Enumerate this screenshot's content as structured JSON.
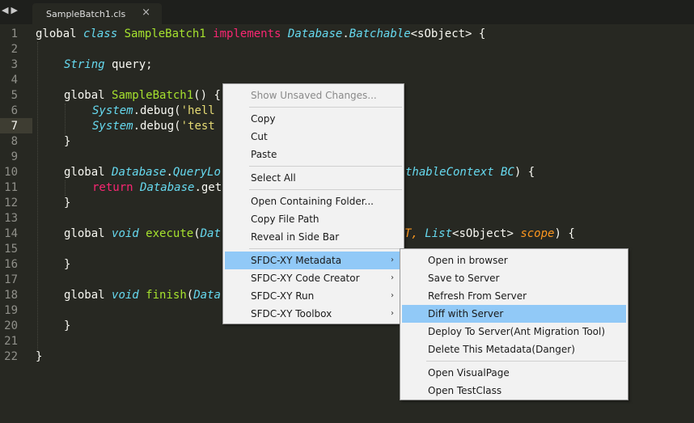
{
  "tabs": [
    {
      "label": "SampleBatch1.cls",
      "close_icon": "×"
    }
  ],
  "nav": {
    "back_icon": "◀",
    "forward_icon": "▶"
  },
  "gutter": {
    "line_numbers": [
      "1",
      "2",
      "3",
      "4",
      "5",
      "6",
      "7",
      "8",
      "9",
      "10",
      "11",
      "12",
      "13",
      "14",
      "15",
      "16",
      "17",
      "18",
      "19",
      "20",
      "21",
      "22"
    ],
    "active_line": "7"
  },
  "code": {
    "l1": {
      "a": "global ",
      "b": "class ",
      "c": "SampleBatch1 ",
      "d": "implements ",
      "e": "Database",
      "f": ".",
      "g": "Batchable",
      "h": "<sObject> {"
    },
    "l3": {
      "a": "String",
      "b": " query;"
    },
    "l5": {
      "a": "global ",
      "b": "SampleBatch1",
      "c": "() {"
    },
    "l6": {
      "a": "System",
      "b": ".debug(",
      "c": "'hell"
    },
    "l7": {
      "a": "System",
      "b": ".debug(",
      "c": "'test"
    },
    "l8": {
      "a": "}"
    },
    "l10": {
      "a": "global ",
      "b": "Database",
      "c": ".",
      "d": "QueryLo",
      "e": "thableContext BC",
      "f": ") {"
    },
    "l11": {
      "a": "return ",
      "b": "Database",
      "c": ".get"
    },
    "l12": {
      "a": "}"
    },
    "l14": {
      "a": "global ",
      "b": "void ",
      "c": "execute",
      "d": "(",
      "e": "Dat",
      "f": "T, ",
      "g": "List",
      "h": "<sObject> ",
      "i": "scope",
      "j": ") {"
    },
    "l16": {
      "a": "}"
    },
    "l18": {
      "a": "global ",
      "b": "void ",
      "c": "finish",
      "d": "(",
      "e": "Data"
    },
    "l20": {
      "a": "}"
    },
    "l22": {
      "a": "}"
    }
  },
  "context_menu": {
    "items": [
      {
        "label": "Show Unsaved Changes...",
        "disabled": true
      },
      {
        "label": "Copy"
      },
      {
        "label": "Cut"
      },
      {
        "label": "Paste"
      },
      {
        "label": "Select All"
      },
      {
        "label": "Open Containing Folder..."
      },
      {
        "label": "Copy File Path"
      },
      {
        "label": "Reveal in Side Bar"
      },
      {
        "label": "SFDC-XY Metadata",
        "submenu": true
      },
      {
        "label": "SFDC-XY Code Creator",
        "submenu": true
      },
      {
        "label": "SFDC-XY Run",
        "submenu": true
      },
      {
        "label": "SFDC-XY Toolbox",
        "submenu": true
      }
    ],
    "submenu_arrow": "›"
  },
  "submenu": {
    "items": [
      {
        "label": "Open in browser"
      },
      {
        "label": "Save to Server"
      },
      {
        "label": "Refresh From Server"
      },
      {
        "label": "Diff with Server"
      },
      {
        "label": "Deploy To Server(Ant Migration Tool)"
      },
      {
        "label": "Delete This Metadata(Danger)"
      },
      {
        "label": "Open VisualPage"
      },
      {
        "label": "Open TestClass"
      }
    ]
  },
  "colors": {
    "background": "#272822",
    "keyword": "#f92672",
    "type": "#66d9ef",
    "function": "#a6e22e",
    "string": "#e6db74",
    "param": "#fd971f",
    "menu_highlight": "#91c9f7"
  }
}
